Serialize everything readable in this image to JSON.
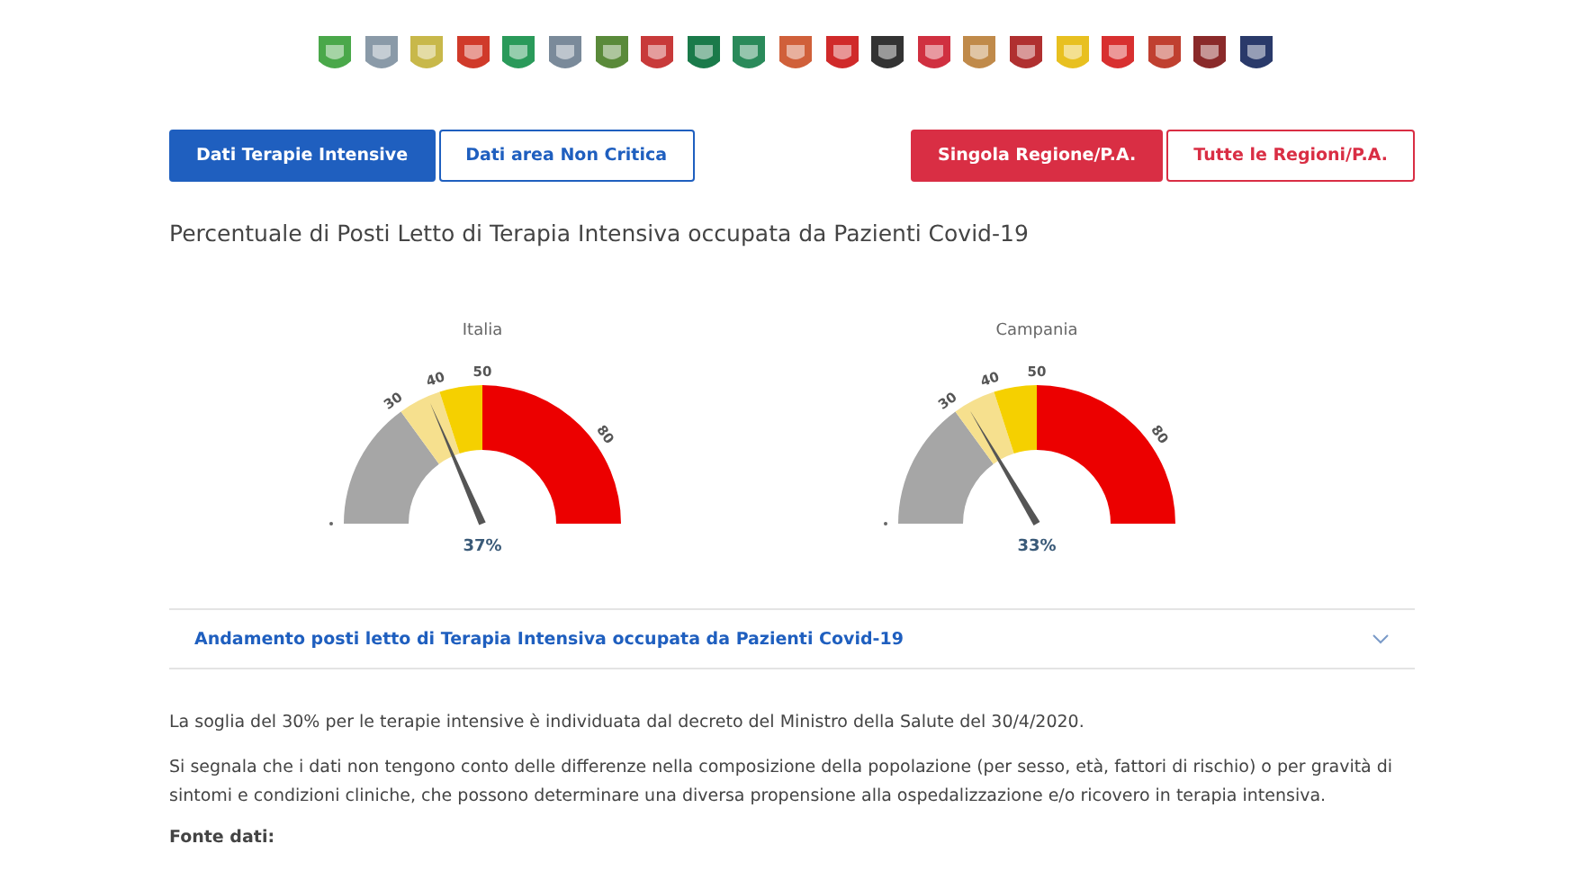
{
  "regions": [
    {
      "color": "#4aa84a"
    },
    {
      "color": "#8a9aa8"
    },
    {
      "color": "#c8b84a"
    },
    {
      "color": "#d03a2a"
    },
    {
      "color": "#2a9a5a"
    },
    {
      "color": "#7a8a9a"
    },
    {
      "color": "#5a8a3a"
    },
    {
      "color": "#c83a3a"
    },
    {
      "color": "#1a7a4a"
    },
    {
      "color": "#2a8a5a"
    },
    {
      "color": "#d0603a"
    },
    {
      "color": "#d02a2a"
    },
    {
      "color": "#333333"
    },
    {
      "color": "#d03040"
    },
    {
      "color": "#c08a4a"
    },
    {
      "color": "#b03030"
    },
    {
      "color": "#e8c020"
    },
    {
      "color": "#d83030"
    },
    {
      "color": "#c04030"
    },
    {
      "color": "#8a2a2a"
    },
    {
      "color": "#2a3a6a"
    }
  ],
  "data_tabs": [
    {
      "label": "Dati Terapie Intensive",
      "selected": true
    },
    {
      "label": "Dati area Non Critica",
      "selected": false
    }
  ],
  "scope_tabs": [
    {
      "label": "Singola Regione/P.A.",
      "selected": true
    },
    {
      "label": "Tutte le Regioni/P.A.",
      "selected": false
    }
  ],
  "heading": "Percentuale di Posti Letto di Terapia Intensiva occupata da Pazienti Covid-19",
  "gauges": [
    {
      "title": "Italia",
      "value": "37%",
      "ticks": [
        "30",
        "40",
        "50",
        "80"
      ]
    },
    {
      "title": "Campania",
      "value": "33%",
      "ticks": [
        "30",
        "40",
        "50",
        "80"
      ]
    }
  ],
  "accordion": {
    "title": "Andamento posti letto di Terapia Intensiva occupata da Pazienti Covid-19",
    "expanded": false
  },
  "notes": [
    "La soglia del 30% per le terapie intensive è individuata dal decreto del Ministro della Salute del 30/4/2020.",
    "Si segnala che i dati non tengono conto delle differenze nella composizione della popolazione (per sesso, età, fattori di rischio) o per gravità di sintomi e condizioni cliniche, che possono determinare una diversa propensione alla ospedalizzazione e/o ricovero in terapia intensiva."
  ],
  "source_label": "Fonte dati:"
}
